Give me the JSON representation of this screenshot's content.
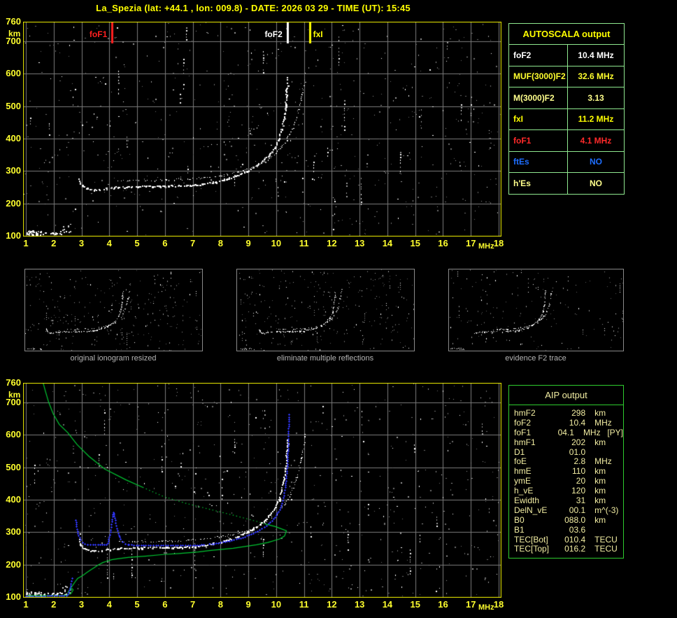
{
  "title": "La_Spezia (lat: +44.1 , lon: 009.8) - DATE: 2026 03 29 - TIME (UT): 15:45",
  "autoscala": {
    "header": "AUTOSCALA output",
    "rows": [
      {
        "label": "foF2",
        "value": "10.4 MHz",
        "color": "#ffffff"
      },
      {
        "label": "MUF(3000)F2",
        "value": "32.6 MHz",
        "color": "#ffff2e"
      },
      {
        "label": "M(3000)F2",
        "value": "3.13",
        "color": "#ffff8c"
      },
      {
        "label": "fxI",
        "value": "11.2 MHz",
        "color": "#ffff00"
      },
      {
        "label": "foF1",
        "value": "4.1 MHz",
        "color": "#ff2a2a"
      },
      {
        "label": "ftEs",
        "value": "NO",
        "color": "#1e6eff"
      },
      {
        "label": "h'Es",
        "value": "NO",
        "color": "#ffff8c"
      }
    ]
  },
  "aip": {
    "header": "AIP output",
    "rows": [
      {
        "name": "hmF2",
        "value": "298",
        "unit": "km",
        "extra": ""
      },
      {
        "name": "foF2",
        "value": "10.4",
        "unit": "MHz",
        "extra": ""
      },
      {
        "name": "foF1",
        "value": "04.1",
        "unit": "MHz",
        "extra": "[PY]"
      },
      {
        "name": "hmF1",
        "value": "202",
        "unit": "km",
        "extra": ""
      },
      {
        "name": "D1",
        "value": "01.0",
        "unit": "",
        "extra": ""
      },
      {
        "name": "foE",
        "value": "2.8",
        "unit": "MHz",
        "extra": ""
      },
      {
        "name": "hmE",
        "value": "110",
        "unit": "km",
        "extra": ""
      },
      {
        "name": "ymE",
        "value": "20",
        "unit": "km",
        "extra": ""
      },
      {
        "name": "h_vE",
        "value": "120",
        "unit": "km",
        "extra": ""
      },
      {
        "name": "Ewidth",
        "value": "31",
        "unit": "km",
        "extra": ""
      },
      {
        "name": "DelN_vE",
        "value": "00.1",
        "unit": "m^(-3)",
        "extra": ""
      },
      {
        "name": "B0",
        "value": "088.0",
        "unit": "km",
        "extra": ""
      },
      {
        "name": "B1",
        "value": "03.6",
        "unit": "",
        "extra": ""
      },
      {
        "name": "TEC[Bot]",
        "value": "010.4",
        "unit": "TECU",
        "extra": ""
      },
      {
        "name": "TEC[Top]",
        "value": "016.2",
        "unit": "TECU",
        "extra": ""
      }
    ]
  },
  "thumbnails": [
    {
      "caption": "original ionogram resized"
    },
    {
      "caption": "eliminate multiple reflections"
    },
    {
      "caption": "evidence F2 trace"
    }
  ],
  "chart_data": {
    "type": "scatter",
    "title": "ionogram",
    "xlabel": "MHz",
    "ylabel": "km",
    "x_range": [
      1,
      18
    ],
    "y_range": [
      100,
      760
    ],
    "grid": true,
    "x_ticks": [
      "1",
      "2",
      "3",
      "4",
      "5",
      "6",
      "7",
      "8",
      "9",
      "10",
      "11",
      "12",
      "13",
      "14",
      "15",
      "16",
      "17",
      "18"
    ],
    "y_ticks": [
      {
        "label": "760",
        "km": 760
      },
      {
        "label": "700",
        "km": 700
      },
      {
        "label": "600",
        "km": 600
      },
      {
        "label": "500",
        "km": 500
      },
      {
        "label": "400",
        "km": 400
      },
      {
        "label": "300",
        "km": 300
      },
      {
        "label": "200",
        "km": 200
      },
      {
        "label": "100",
        "km": 100
      }
    ],
    "markers": [
      {
        "label": "foF1",
        "f": 4.1,
        "color": "#ff2020",
        "side": "left"
      },
      {
        "label": "foF2",
        "f": 10.4,
        "color": "#ffffff",
        "side": "left"
      },
      {
        "label": "fxI",
        "f": 11.2,
        "color": "#ffff00",
        "side": "right"
      }
    ],
    "traces": {
      "o_mode": {
        "color": "#ffffff",
        "points": [
          [
            2.88,
            277
          ],
          [
            2.95,
            263
          ],
          [
            3.08,
            251
          ],
          [
            3.3,
            243
          ],
          [
            3.6,
            243
          ],
          [
            3.9,
            248
          ],
          [
            4.3,
            251
          ],
          [
            5.0,
            253
          ],
          [
            5.8,
            254
          ],
          [
            6.5,
            255
          ],
          [
            7.0,
            257
          ],
          [
            7.4,
            261
          ],
          [
            7.8,
            267
          ],
          [
            8.2,
            276
          ],
          [
            8.6,
            288
          ],
          [
            9.0,
            303
          ],
          [
            9.3,
            318
          ],
          [
            9.6,
            339
          ],
          [
            9.8,
            358
          ],
          [
            9.95,
            377
          ],
          [
            10.08,
            400
          ],
          [
            10.18,
            428
          ],
          [
            10.26,
            462
          ],
          [
            10.32,
            500
          ],
          [
            10.36,
            545
          ],
          [
            10.39,
            588
          ]
        ]
      },
      "x_mode": {
        "color": "#ffffff",
        "points": [
          [
            4.3,
            271
          ],
          [
            5.0,
            272
          ],
          [
            6.0,
            273
          ],
          [
            6.8,
            276
          ],
          [
            7.4,
            280
          ],
          [
            8.0,
            287
          ],
          [
            8.6,
            297
          ],
          [
            9.1,
            310
          ],
          [
            9.6,
            330
          ],
          [
            10.0,
            356
          ],
          [
            10.3,
            388
          ],
          [
            10.5,
            417
          ],
          [
            10.66,
            450
          ],
          [
            10.8,
            490
          ],
          [
            10.9,
            528
          ],
          [
            10.98,
            565
          ],
          [
            11.04,
            600
          ]
        ]
      },
      "e_layer": {
        "f_range": [
          1.0,
          2.45
        ],
        "km_range": [
          104,
          118
        ]
      }
    },
    "profile_green": {
      "color": "#00c832",
      "topside_solid": [
        [
          1.62,
          760
        ],
        [
          1.7,
          735
        ],
        [
          1.82,
          700
        ],
        [
          1.98,
          665
        ],
        [
          2.2,
          632
        ],
        [
          2.5,
          607
        ],
        [
          2.84,
          570
        ],
        [
          3.26,
          534
        ],
        [
          3.84,
          494
        ],
        [
          4.6,
          461
        ],
        [
          5.2,
          438
        ]
      ],
      "topside_dotted": [
        [
          5.2,
          438
        ],
        [
          5.94,
          410
        ],
        [
          6.78,
          388
        ],
        [
          7.62,
          370
        ],
        [
          8.46,
          352
        ],
        [
          9.3,
          333
        ],
        [
          9.6,
          325
        ]
      ],
      "bottomside_solid": [
        [
          9.6,
          325
        ],
        [
          9.97,
          317
        ],
        [
          10.37,
          304
        ],
        [
          10.3,
          288
        ],
        [
          10.13,
          279
        ],
        [
          9.7,
          268
        ],
        [
          9.29,
          261
        ],
        [
          8.45,
          250
        ],
        [
          7.6,
          243
        ],
        [
          7.2,
          239
        ],
        [
          6.5,
          234
        ],
        [
          5.94,
          231
        ],
        [
          5.3,
          226
        ],
        [
          4.68,
          222
        ],
        [
          4.3,
          218
        ],
        [
          4.09,
          215
        ],
        [
          3.9,
          210
        ],
        [
          3.76,
          206
        ],
        [
          3.59,
          198
        ],
        [
          3.45,
          190
        ],
        [
          3.34,
          184
        ],
        [
          3.2,
          176
        ],
        [
          3.09,
          169
        ],
        [
          2.96,
          162
        ],
        [
          2.86,
          157
        ],
        [
          2.78,
          148
        ],
        [
          2.7,
          138
        ],
        [
          2.62,
          128
        ],
        [
          2.54,
          118
        ],
        [
          2.5,
          112
        ],
        [
          2.56,
          121
        ],
        [
          2.66,
          126
        ],
        [
          2.7,
          122
        ],
        [
          2.62,
          110
        ],
        [
          2.5,
          106
        ],
        [
          2.3,
          104
        ],
        [
          1.9,
          104
        ],
        [
          1.5,
          104
        ],
        [
          1.05,
          104
        ]
      ]
    },
    "restored_trace_blue": {
      "color": "#3238ff",
      "segments": [
        [
          [
            1.0,
            103
          ],
          [
            1.6,
            103
          ],
          [
            2.45,
            105
          ]
        ],
        [
          [
            2.5,
            108
          ],
          [
            2.56,
            122
          ],
          [
            2.62,
            140
          ],
          [
            2.66,
            158
          ]
        ],
        [
          [
            2.79,
            338
          ],
          [
            2.83,
            310
          ],
          [
            2.89,
            290
          ],
          [
            2.96,
            277
          ],
          [
            3.03,
            268
          ],
          [
            3.12,
            264
          ]
        ],
        [
          [
            3.12,
            263
          ],
          [
            3.5,
            262
          ],
          [
            3.9,
            262
          ]
        ],
        [
          [
            3.93,
            266
          ],
          [
            3.98,
            278
          ],
          [
            4.02,
            292
          ],
          [
            4.05,
            308
          ],
          [
            4.08,
            324
          ],
          [
            4.1,
            340
          ],
          [
            4.13,
            355
          ],
          [
            4.15,
            362
          ],
          [
            4.18,
            351
          ],
          [
            4.21,
            337
          ],
          [
            4.25,
            320
          ],
          [
            4.29,
            304
          ],
          [
            4.34,
            290
          ],
          [
            4.39,
            279
          ],
          [
            4.46,
            270
          ],
          [
            4.56,
            265
          ],
          [
            4.68,
            262
          ]
        ],
        [
          [
            4.7,
            261
          ],
          [
            5.4,
            259
          ],
          [
            6.2,
            259
          ],
          [
            7.0,
            260
          ],
          [
            7.4,
            261
          ]
        ],
        [
          [
            7.6,
            263
          ],
          [
            8.0,
            268
          ],
          [
            8.4,
            275
          ],
          [
            8.8,
            284
          ],
          [
            9.1,
            294
          ],
          [
            9.4,
            307
          ],
          [
            9.65,
            321
          ],
          [
            9.85,
            336
          ],
          [
            10.0,
            352
          ],
          [
            10.12,
            370
          ],
          [
            10.2,
            390
          ],
          [
            10.27,
            413
          ],
          [
            10.32,
            438
          ],
          [
            10.36,
            466
          ],
          [
            10.39,
            497
          ],
          [
            10.41,
            531
          ],
          [
            10.43,
            572
          ],
          [
            10.44,
            612
          ],
          [
            10.45,
            648
          ],
          [
            10.46,
            662
          ]
        ]
      ]
    }
  }
}
